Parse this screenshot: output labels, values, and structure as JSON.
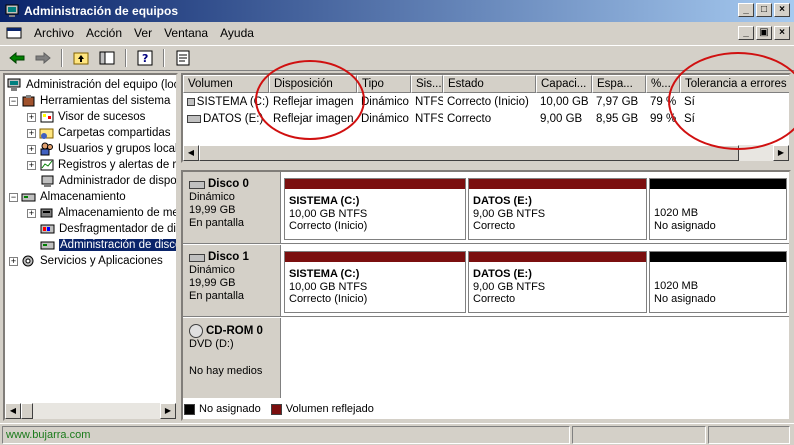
{
  "window": {
    "title": "Administración de equipos",
    "controls": [
      "_",
      "□",
      "×"
    ],
    "mdi_controls": [
      "_",
      "▣",
      "×"
    ]
  },
  "menu": {
    "items": [
      {
        "label": "Archivo"
      },
      {
        "label": "Acción"
      },
      {
        "label": "Ver"
      },
      {
        "label": "Ventana"
      },
      {
        "label": "Ayuda"
      }
    ]
  },
  "tree": {
    "root": "Administración del equipo (local)",
    "nodes": [
      {
        "label": "Herramientas del sistema",
        "level": 1
      },
      {
        "label": "Visor de sucesos",
        "level": 2
      },
      {
        "label": "Carpetas compartidas",
        "level": 2
      },
      {
        "label": "Usuarios y grupos locales",
        "level": 2
      },
      {
        "label": "Registros y alertas de rendimiento",
        "level": 2
      },
      {
        "label": "Administrador de dispositivos",
        "level": 2
      },
      {
        "label": "Almacenamiento",
        "level": 1
      },
      {
        "label": "Almacenamiento de medios extraíbles",
        "level": 2
      },
      {
        "label": "Desfragmentador de disco",
        "level": 2
      },
      {
        "label": "Administración de discos",
        "level": 2
      },
      {
        "label": "Servicios y Aplicaciones",
        "level": 1
      }
    ]
  },
  "volumes": {
    "columns": [
      "Volumen",
      "Disposición",
      "Tipo",
      "Sistema de archivos",
      "Estado",
      "Capacidad",
      "Espacio libre",
      "% libre",
      "Tolerancia a errores"
    ],
    "column_labels": [
      "Volumen",
      "Disposición",
      "Tipo",
      "Sis...",
      "Estado",
      "Capaci...",
      "Espa...",
      "%...",
      "Tolerancia a errores"
    ],
    "rows": [
      [
        "SISTEMA (C:)",
        "Reflejar imagen",
        "Dinámico",
        "NTFS",
        "Correcto (Inicio)",
        "10,00 GB",
        "7,97 GB",
        "79 %",
        "Sí"
      ],
      [
        "DATOS (E:)",
        "Reflejar imagen",
        "Dinámico",
        "NTFS",
        "Correcto",
        "9,00 GB",
        "8,95 GB",
        "99 %",
        "Sí"
      ]
    ]
  },
  "disks": [
    {
      "name": "Disco 0",
      "type": "Dinámico",
      "size": "19,99 GB",
      "state": "En pantalla",
      "partitions": [
        {
          "name": "SISTEMA  (C:)",
          "detail": "10,00 GB NTFS",
          "status": "Correcto (Inicio)",
          "kind": "mirror"
        },
        {
          "name": "DATOS  (E:)",
          "detail": "9,00 GB NTFS",
          "status": "Correcto",
          "kind": "mirror"
        },
        {
          "name": "",
          "detail": "1020 MB",
          "status": "No asignado",
          "kind": "unallocated"
        }
      ]
    },
    {
      "name": "Disco 1",
      "type": "Dinámico",
      "size": "19,99 GB",
      "state": "En pantalla",
      "partitions": [
        {
          "name": "SISTEMA  (C:)",
          "detail": "10,00 GB NTFS",
          "status": "Correcto (Inicio)",
          "kind": "mirror"
        },
        {
          "name": "DATOS  (E:)",
          "detail": "9,00 GB NTFS",
          "status": "Correcto",
          "kind": "mirror"
        },
        {
          "name": "",
          "detail": "1020 MB",
          "status": "No asignado",
          "kind": "unallocated"
        }
      ]
    },
    {
      "name": "CD-ROM 0",
      "type": "DVD (D:)",
      "size": "",
      "state": "No hay medios",
      "partitions": []
    }
  ],
  "legend": [
    {
      "label": "No asignado",
      "color": "#000000"
    },
    {
      "label": "Volumen reflejado",
      "color": "#7b0f0f"
    }
  ],
  "status": {
    "watermark": "www.bujarra.com"
  },
  "colors": {
    "mirror": "#7b0f0f",
    "unallocated": "#000000",
    "annotation": "#d01010"
  }
}
